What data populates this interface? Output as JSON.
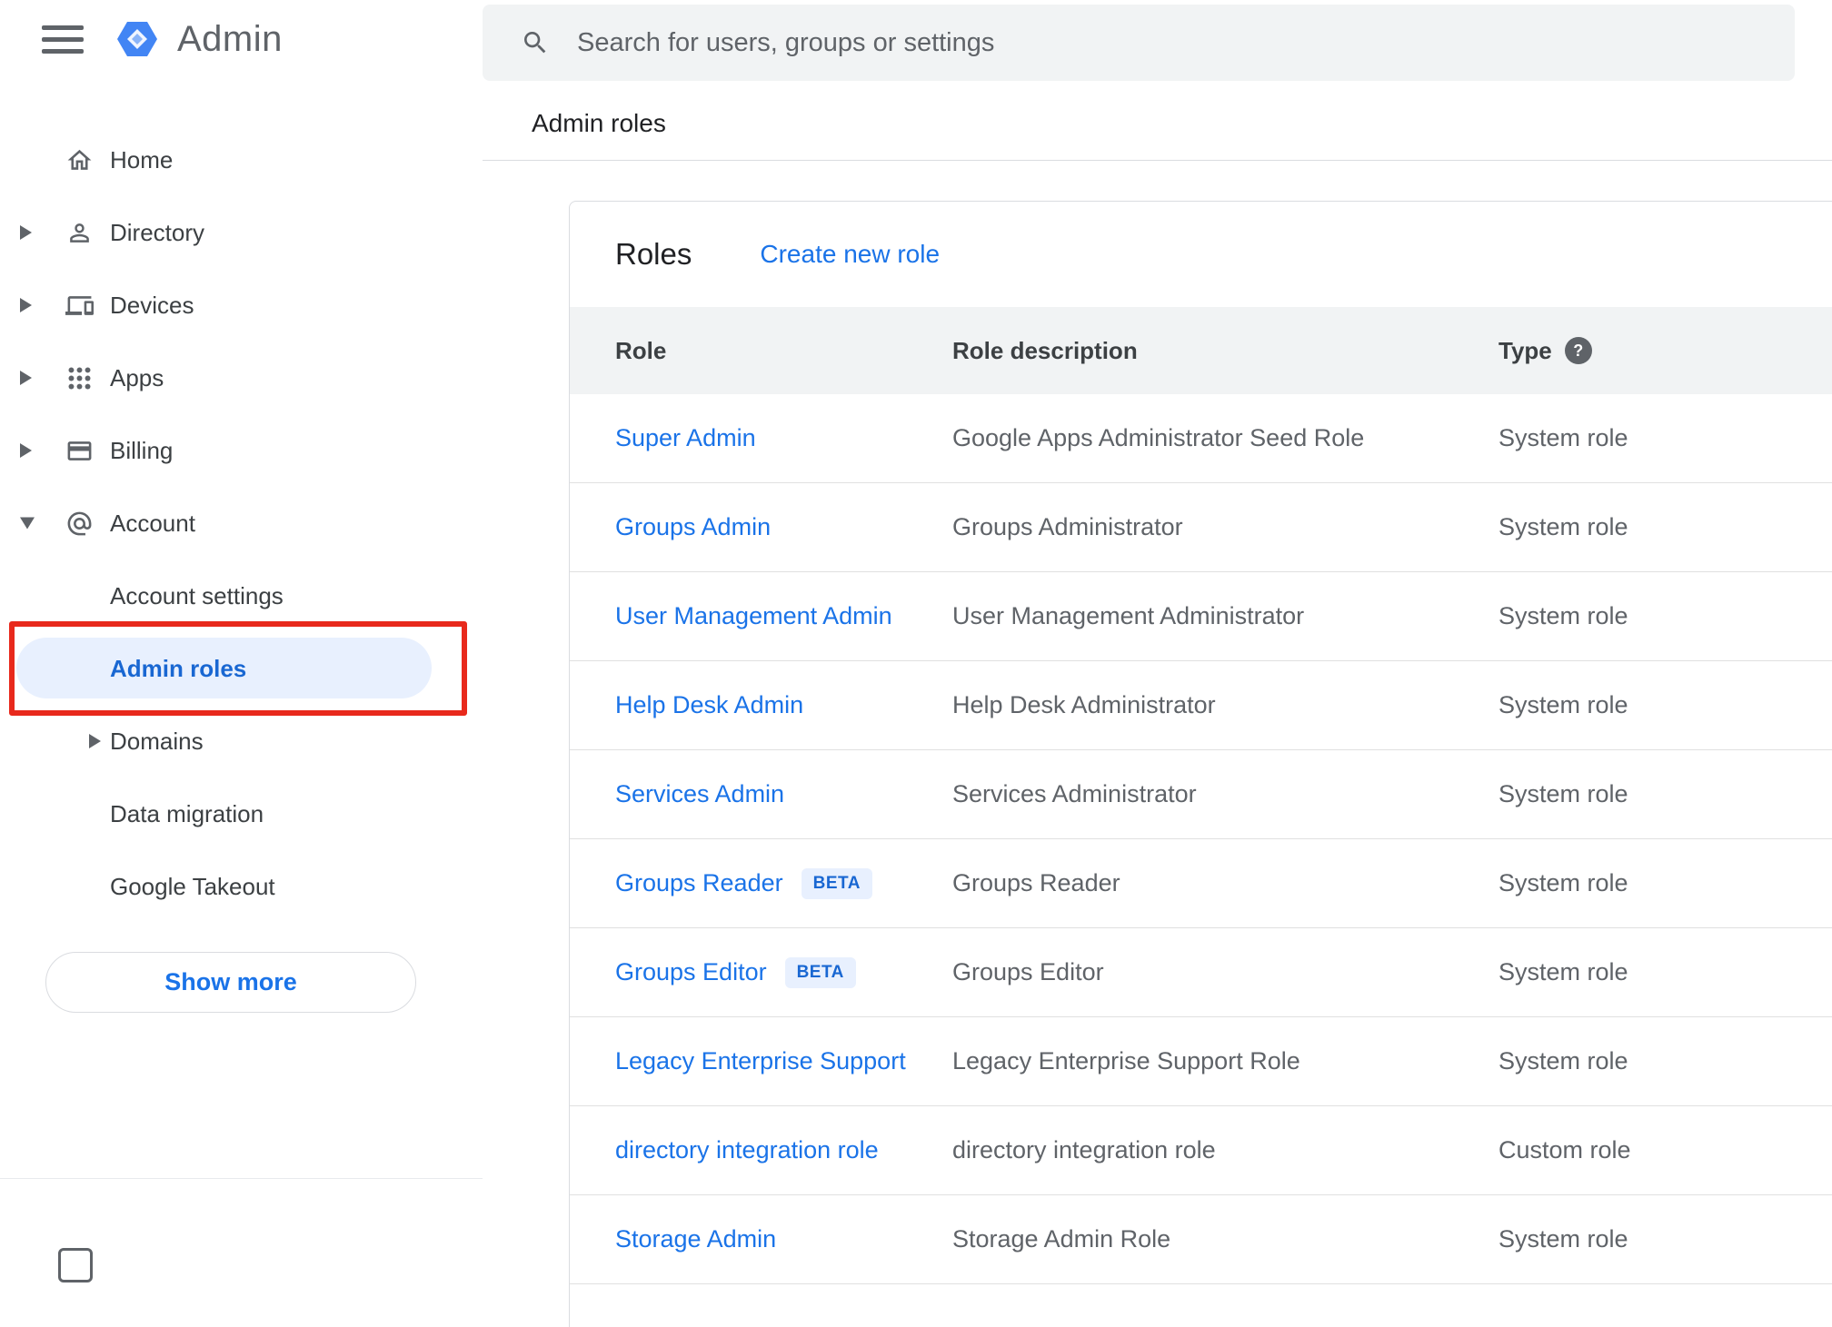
{
  "colors": {
    "link_blue": "#1a73e8",
    "active_item_blue": "#1967d2",
    "active_item_bg": "#e8f0fe",
    "table_header_bg": "#f1f3f4",
    "text_primary": "#202124",
    "text_secondary": "#5f6368",
    "divider": "#dadce0",
    "annotation_red": "#e8291c",
    "logo_blue": "#4285f4"
  },
  "header": {
    "app_title": "Admin",
    "search_placeholder": "Search for users, groups or settings"
  },
  "breadcrumb": "Admin roles",
  "sidebar": {
    "items": [
      {
        "label": "Home",
        "icon": "home"
      },
      {
        "label": "Directory",
        "icon": "person"
      },
      {
        "label": "Devices",
        "icon": "devices"
      },
      {
        "label": "Apps",
        "icon": "apps-grid"
      },
      {
        "label": "Billing",
        "icon": "credit-card"
      },
      {
        "label": "Account",
        "icon": "at-sign"
      }
    ],
    "account_children": [
      {
        "label": "Account settings"
      },
      {
        "label": "Admin roles",
        "active": true
      },
      {
        "label": "Domains",
        "expandable": true
      },
      {
        "label": "Data migration"
      },
      {
        "label": "Google Takeout"
      }
    ],
    "show_more_label": "Show more"
  },
  "main": {
    "card_title": "Roles",
    "create_link": "Create new role",
    "table": {
      "headers": {
        "role": "Role",
        "description": "Role description",
        "type": "Type"
      },
      "help_glyph": "?",
      "beta_label": "BETA",
      "rows": [
        {
          "role": "Super Admin",
          "description": "Google Apps Administrator Seed Role",
          "type": "System role",
          "beta": false
        },
        {
          "role": "Groups Admin",
          "description": "Groups Administrator",
          "type": "System role",
          "beta": false
        },
        {
          "role": "User Management Admin",
          "description": "User Management Administrator",
          "type": "System role",
          "beta": false
        },
        {
          "role": "Help Desk Admin",
          "description": "Help Desk Administrator",
          "type": "System role",
          "beta": false
        },
        {
          "role": "Services Admin",
          "description": "Services Administrator",
          "type": "System role",
          "beta": false
        },
        {
          "role": "Groups Reader",
          "description": "Groups Reader",
          "type": "System role",
          "beta": true
        },
        {
          "role": "Groups Editor",
          "description": "Groups Editor",
          "type": "System role",
          "beta": true
        },
        {
          "role": "Legacy Enterprise Support",
          "description": "Legacy Enterprise Support Role",
          "type": "System role",
          "beta": false
        },
        {
          "role": "directory integration role",
          "description": "directory integration role",
          "type": "Custom role",
          "beta": false
        },
        {
          "role": "Storage Admin",
          "description": "Storage Admin Role",
          "type": "System role",
          "beta": false
        }
      ]
    }
  }
}
